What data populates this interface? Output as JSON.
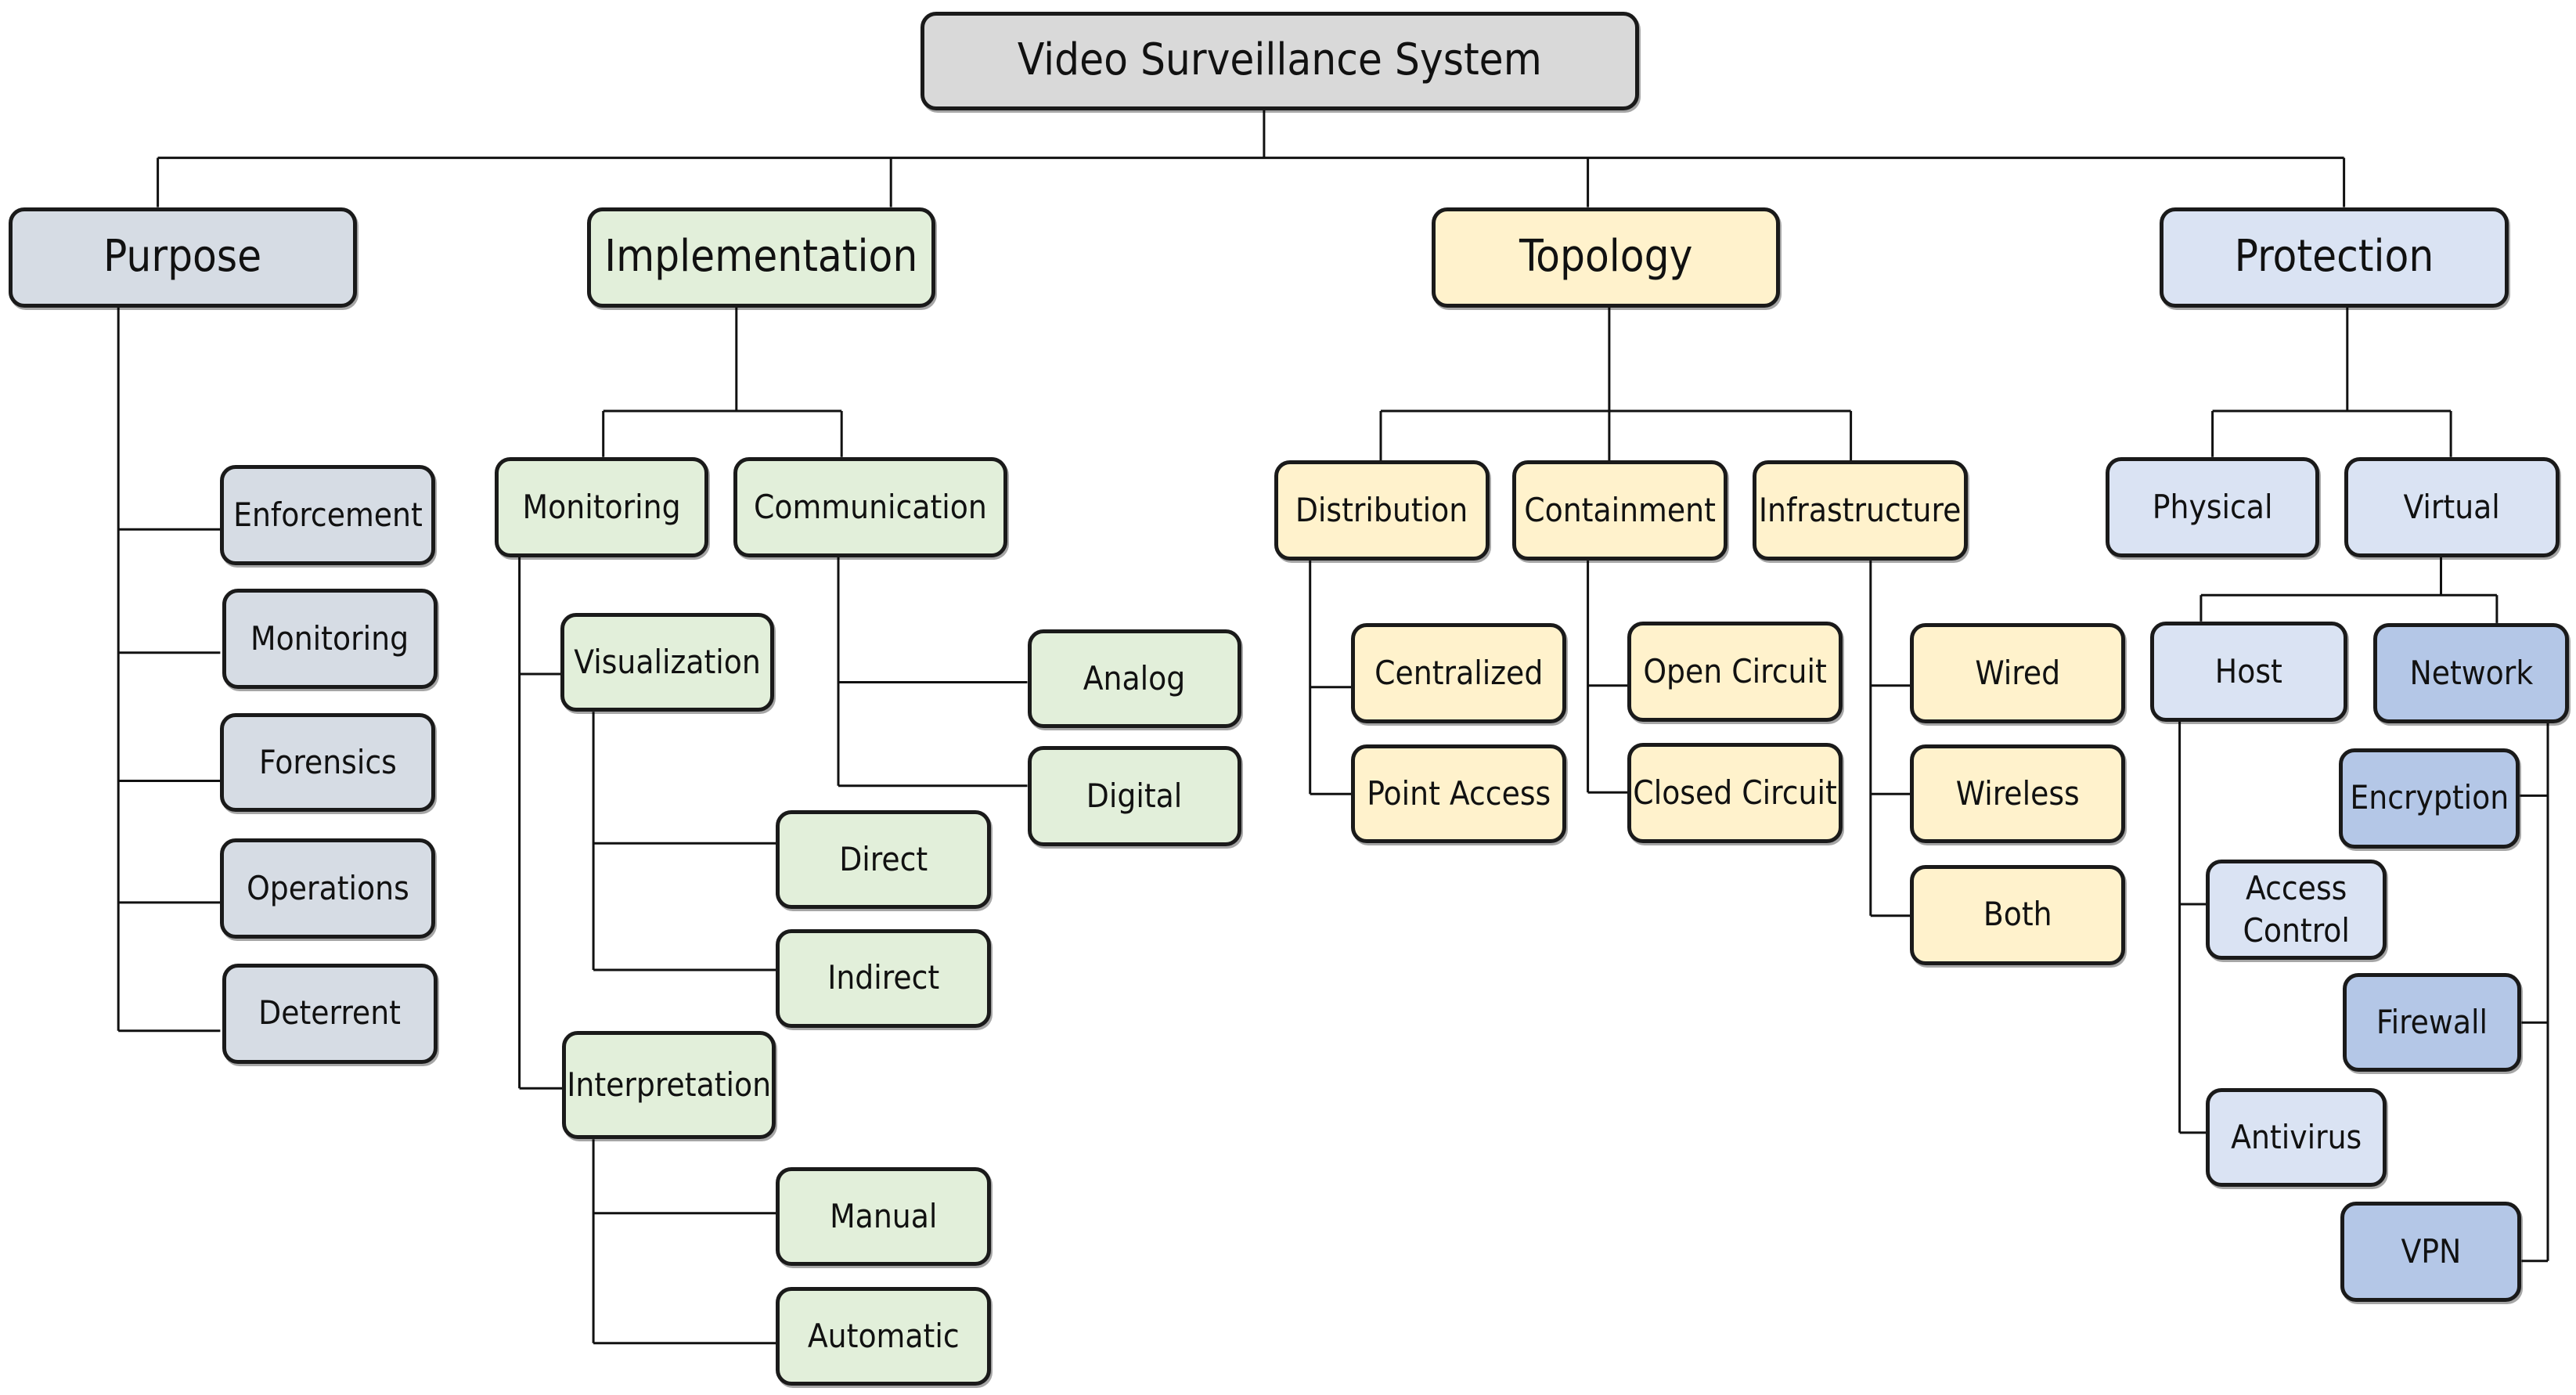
{
  "diagram": {
    "title": "Video Surveillance System",
    "colors": {
      "root": "#D9D9D9",
      "purpose": "#D6DCE4",
      "implementation": "#E2EFDA",
      "topology": "#FFF2CC",
      "protection": "#DAE3F3",
      "protection_network": "#B4C7E7"
    },
    "nodes": [
      {
        "id": "root",
        "label": "Video Surveillance System",
        "color": "root",
        "level": 0
      },
      {
        "id": "purpose",
        "label": "Purpose",
        "color": "purpose",
        "level": 1,
        "parent": "root"
      },
      {
        "id": "implementation",
        "label": "Implementation",
        "color": "implementation",
        "level": 1,
        "parent": "root"
      },
      {
        "id": "topology",
        "label": "Topology",
        "color": "topology",
        "level": 1,
        "parent": "root"
      },
      {
        "id": "protection",
        "label": "Protection",
        "color": "protection",
        "level": 1,
        "parent": "root"
      },
      {
        "id": "enforcement",
        "label": "Enforcement",
        "color": "purpose",
        "level": 2,
        "parent": "purpose"
      },
      {
        "id": "p-monitoring",
        "label": "Monitoring",
        "color": "purpose",
        "level": 2,
        "parent": "purpose"
      },
      {
        "id": "forensics",
        "label": "Forensics",
        "color": "purpose",
        "level": 2,
        "parent": "purpose"
      },
      {
        "id": "operations",
        "label": "Operations",
        "color": "purpose",
        "level": 2,
        "parent": "purpose"
      },
      {
        "id": "deterrent",
        "label": "Deterrent",
        "color": "purpose",
        "level": 2,
        "parent": "purpose"
      },
      {
        "id": "i-monitoring",
        "label": "Monitoring",
        "color": "implementation",
        "level": 2,
        "parent": "implementation"
      },
      {
        "id": "communication",
        "label": "Communication",
        "color": "implementation",
        "level": 2,
        "parent": "implementation"
      },
      {
        "id": "visualization",
        "label": "Visualization",
        "color": "implementation",
        "level": 3,
        "parent": "i-monitoring"
      },
      {
        "id": "interpretation",
        "label": "Interpretation",
        "color": "implementation",
        "level": 3,
        "parent": "i-monitoring"
      },
      {
        "id": "direct",
        "label": "Direct",
        "color": "implementation",
        "level": 3,
        "parent": "visualization"
      },
      {
        "id": "indirect",
        "label": "Indirect",
        "color": "implementation",
        "level": 3,
        "parent": "visualization"
      },
      {
        "id": "manual",
        "label": "Manual",
        "color": "implementation",
        "level": 3,
        "parent": "interpretation"
      },
      {
        "id": "automatic",
        "label": "Automatic",
        "color": "implementation",
        "level": 3,
        "parent": "interpretation"
      },
      {
        "id": "analog",
        "label": "Analog",
        "color": "implementation",
        "level": 3,
        "parent": "communication"
      },
      {
        "id": "digital",
        "label": "Digital",
        "color": "implementation",
        "level": 3,
        "parent": "communication"
      },
      {
        "id": "distribution",
        "label": "Distribution",
        "color": "topology",
        "level": 2,
        "parent": "topology"
      },
      {
        "id": "containment",
        "label": "Containment",
        "color": "topology",
        "level": 2,
        "parent": "topology"
      },
      {
        "id": "infrastructure",
        "label": "Infrastructure",
        "color": "topology",
        "level": 2,
        "parent": "topology"
      },
      {
        "id": "centralized",
        "label": "Centralized",
        "color": "topology",
        "level": 3,
        "parent": "distribution"
      },
      {
        "id": "point-access",
        "label": "Point Access",
        "color": "topology",
        "level": 3,
        "parent": "distribution"
      },
      {
        "id": "open-circuit",
        "label": "Open Circuit",
        "color": "topology",
        "level": 3,
        "parent": "containment"
      },
      {
        "id": "closed-circuit",
        "label": "Closed Circuit",
        "color": "topology",
        "level": 3,
        "parent": "containment"
      },
      {
        "id": "wired",
        "label": "Wired",
        "color": "topology",
        "level": 3,
        "parent": "infrastructure"
      },
      {
        "id": "wireless",
        "label": "Wireless",
        "color": "topology",
        "level": 3,
        "parent": "infrastructure"
      },
      {
        "id": "both",
        "label": "Both",
        "color": "topology",
        "level": 3,
        "parent": "infrastructure"
      },
      {
        "id": "physical",
        "label": "Physical",
        "color": "protection",
        "level": 2,
        "parent": "protection"
      },
      {
        "id": "virtual",
        "label": "Virtual",
        "color": "protection",
        "level": 2,
        "parent": "protection"
      },
      {
        "id": "host",
        "label": "Host",
        "color": "protection",
        "level": 3,
        "parent": "virtual"
      },
      {
        "id": "network",
        "label": "Network",
        "color": "protection_network",
        "level": 3,
        "parent": "virtual"
      },
      {
        "id": "access-control",
        "label": "Access\nControl",
        "color": "protection",
        "level": 3,
        "parent": "host"
      },
      {
        "id": "antivirus",
        "label": "Antivirus",
        "color": "protection",
        "level": 3,
        "parent": "host"
      },
      {
        "id": "encryption",
        "label": "Encryption",
        "color": "protection_network",
        "level": 3,
        "parent": "network"
      },
      {
        "id": "firewall",
        "label": "Firewall",
        "color": "protection_network",
        "level": 3,
        "parent": "network"
      },
      {
        "id": "vpn",
        "label": "VPN",
        "color": "protection_network",
        "level": 3,
        "parent": "network"
      }
    ]
  }
}
